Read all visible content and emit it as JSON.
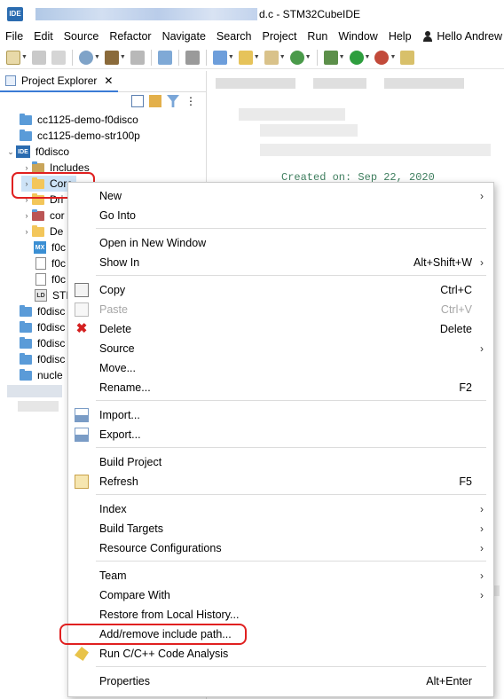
{
  "window": {
    "app_icon_text": "IDE",
    "title_suffix": "d.c - STM32CubeIDE"
  },
  "menubar": {
    "items": [
      "File",
      "Edit",
      "Source",
      "Refactor",
      "Navigate",
      "Search",
      "Project",
      "Run",
      "Window",
      "Help"
    ],
    "user": "Hello Andrew"
  },
  "explorer": {
    "tab_label": "Project Explorer",
    "close_glyph": "✕",
    "tree": [
      {
        "label": "cc1125-demo-f0disco"
      },
      {
        "label": "cc1125-demo-str100p"
      },
      {
        "label": "f0disco",
        "badge": "IDE"
      },
      {
        "label": "Includes"
      },
      {
        "label": "Core"
      },
      {
        "label": "Dri"
      },
      {
        "label": "cor"
      },
      {
        "label": "De"
      },
      {
        "label": "f0c",
        "badge": "MX"
      },
      {
        "label": "f0c"
      },
      {
        "label": "f0c"
      },
      {
        "label": "STI",
        "badge": "LD"
      },
      {
        "label": "f0disc"
      },
      {
        "label": "f0disc"
      },
      {
        "label": "f0disc"
      },
      {
        "label": "f0disc"
      },
      {
        "label": "nucle"
      }
    ]
  },
  "editor": {
    "visible_code": "Created on: Sep 22, 2020"
  },
  "context_menu": {
    "items": [
      {
        "label": "New",
        "submenu": true
      },
      {
        "label": "Go Into"
      },
      {
        "label": "Open in New Window"
      },
      {
        "label": "Show In",
        "shortcut": "Alt+Shift+W",
        "submenu": true
      },
      {
        "label": "Copy",
        "shortcut": "Ctrl+C",
        "icon": "copy-icon"
      },
      {
        "label": "Paste",
        "shortcut": "Ctrl+V",
        "icon": "paste-icon",
        "disabled": true
      },
      {
        "label": "Delete",
        "shortcut": "Delete",
        "icon": "delete-icon"
      },
      {
        "label": "Source",
        "submenu": true
      },
      {
        "label": "Move..."
      },
      {
        "label": "Rename...",
        "shortcut": "F2"
      },
      {
        "label": "Import...",
        "icon": "import-icon"
      },
      {
        "label": "Export...",
        "icon": "export-icon"
      },
      {
        "label": "Build Project"
      },
      {
        "label": "Refresh",
        "shortcut": "F5",
        "icon": "refresh-icon"
      },
      {
        "label": "Index",
        "submenu": true
      },
      {
        "label": "Build Targets",
        "submenu": true
      },
      {
        "label": "Resource Configurations",
        "submenu": true
      },
      {
        "label": "Team",
        "submenu": true
      },
      {
        "label": "Compare With",
        "submenu": true
      },
      {
        "label": "Restore from Local History..."
      },
      {
        "label": "Add/remove include path..."
      },
      {
        "label": "Run C/C++ Code Analysis",
        "icon": "code-analysis-icon"
      },
      {
        "label": "Properties",
        "shortcut": "Alt+Enter"
      }
    ],
    "submenu_glyph": "›"
  },
  "colors": {
    "highlight": "#e02020",
    "accent": "#3a7bd5"
  }
}
